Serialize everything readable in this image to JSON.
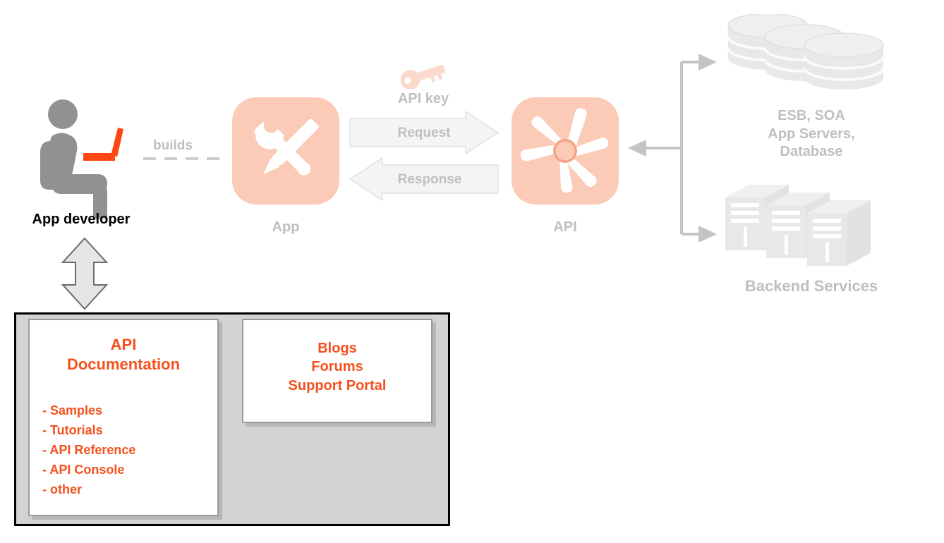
{
  "diagram": {
    "title": "API platform architecture diagram",
    "colors": {
      "salmon_tile": "#fccbb8",
      "orange_text": "#f4511e",
      "gray_label": "#bfbfbf",
      "panel_gray": "#d3d3d3",
      "connector_gray": "#c4c4c4"
    }
  },
  "developer": {
    "icon": "seated-developer-with-laptop-icon",
    "label": "App developer"
  },
  "builds_connector": {
    "label": "builds",
    "style": "dashed"
  },
  "app": {
    "icon": "wrench-and-pencil-icon",
    "label": "App"
  },
  "api": {
    "icon": "api-hub-star-icon",
    "label": "API"
  },
  "api_key": {
    "icon": "key-icon",
    "label": "API key"
  },
  "flows": {
    "request": "Request",
    "response": "Response"
  },
  "backend": {
    "database": {
      "icon": "database-cylinders-icon",
      "label": "ESB, SOA\nApp Servers,\nDatabase"
    },
    "services": {
      "icon": "server-racks-icon",
      "label": "Backend Services"
    }
  },
  "developer_portal": {
    "documentation_card": {
      "title": "API\nDocumentation",
      "items": [
        "- Samples",
        "- Tutorials",
        "- API Reference",
        "- API Console",
        "- other"
      ]
    },
    "community_card": {
      "title": "Blogs\nForums\nSupport Portal"
    }
  }
}
